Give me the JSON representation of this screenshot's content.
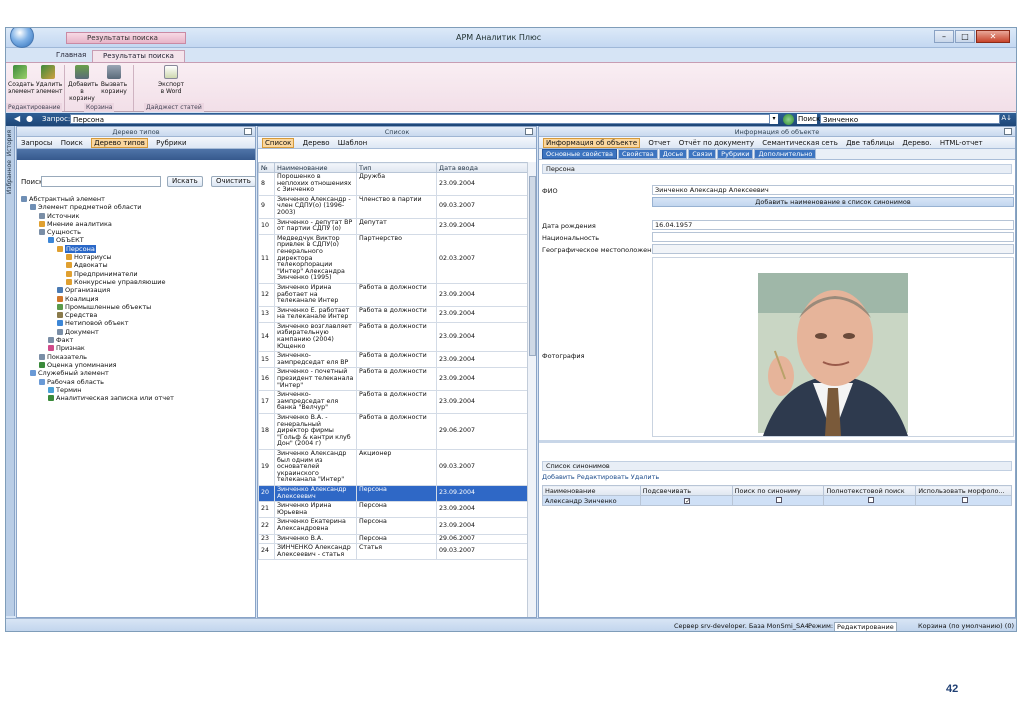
{
  "app": {
    "title": "АРМ Аналитик Плюс",
    "qat_label": "Результаты поиска"
  },
  "ribbon": {
    "tabs": [
      "Главная",
      "Результаты поиска"
    ],
    "buttons": [
      {
        "label": "Создать элемент"
      },
      {
        "label": "Удалить элемент"
      },
      {
        "label": "Добавить в корзину"
      },
      {
        "label": "Вызвать корзину"
      },
      {
        "label": "Экспорт в Word"
      }
    ],
    "groups": [
      "Редактирование",
      "Корзина",
      "Дайджест статей"
    ]
  },
  "querybar": {
    "label": "Запрос:",
    "query": "Персона",
    "search_label": "Поиск",
    "search_value": "Зинченко",
    "sort": "A↓"
  },
  "sidebar": {
    "labels": [
      "История",
      "Избранное"
    ]
  },
  "left": {
    "header": "Дерево типов",
    "toolbar": [
      "Запросы",
      "Поиск",
      "Дерево типов",
      "Рубрики"
    ],
    "search_label": "Поиск",
    "search_btn": "Искать",
    "clear_btn": "Очистить",
    "tree": [
      {
        "d": 0,
        "t": "Абстрактный элемент",
        "c": "#6f8fb5"
      },
      {
        "d": 1,
        "t": "Элемент предметной области",
        "c": "#6f8fb5"
      },
      {
        "d": 2,
        "t": "Источник",
        "c": "#7a8ea6"
      },
      {
        "d": 2,
        "t": "Мнение аналитика",
        "c": "#e0a030"
      },
      {
        "d": 2,
        "t": "Сущность",
        "c": "#7a8ea6"
      },
      {
        "d": 3,
        "t": "ОБЪЕКТ",
        "c": "#3c86d6"
      },
      {
        "d": 4,
        "t": "Персона",
        "c": "#e0a030",
        "sel": true
      },
      {
        "d": 5,
        "t": "Нотариусы",
        "c": "#e0a030"
      },
      {
        "d": 5,
        "t": "Адвокаты",
        "c": "#e0a030"
      },
      {
        "d": 5,
        "t": "Предприниматели",
        "c": "#e0a030"
      },
      {
        "d": 5,
        "t": "Конкурсные управляюшие",
        "c": "#e0a030"
      },
      {
        "d": 4,
        "t": "Организация",
        "c": "#4a7ab3"
      },
      {
        "d": 4,
        "t": "Коалиция",
        "c": "#d0762a"
      },
      {
        "d": 4,
        "t": "Промышленные объекты",
        "c": "#5a9a4a"
      },
      {
        "d": 4,
        "t": "Средства",
        "c": "#8a7a4a"
      },
      {
        "d": 4,
        "t": "Нетиповой объект",
        "c": "#3c86d6"
      },
      {
        "d": 4,
        "t": "Документ",
        "c": "#7a8ea6"
      },
      {
        "d": 3,
        "t": "Факт",
        "c": "#7a8ea6"
      },
      {
        "d": 3,
        "t": "Признак",
        "c": "#d04a8a"
      },
      {
        "d": 2,
        "t": "Показатель",
        "c": "#7a8ea6"
      },
      {
        "d": 2,
        "t": "Оценка упоминания",
        "c": "#3a8a3a"
      },
      {
        "d": 1,
        "t": "Служебный элемент",
        "c": "#6a9ad6"
      },
      {
        "d": 2,
        "t": "Рабочая область",
        "c": "#6a9ad6"
      },
      {
        "d": 3,
        "t": "Термин",
        "c": "#4aa0d6"
      },
      {
        "d": 3,
        "t": "Аналитическая записка или отчет",
        "c": "#3a8a3a"
      }
    ]
  },
  "middle": {
    "header": "Список",
    "toolbar": [
      "Список",
      "Дерево",
      "Шаблон"
    ],
    "columns": [
      "№",
      "Наименование",
      "Тип",
      "Дата ввода"
    ],
    "rows": [
      {
        "n": "8",
        "name": "Порошенко в неплохих отношениях с Зинченко",
        "type": "Дружба",
        "date": "23.09.2004"
      },
      {
        "n": "9",
        "name": "Зинченко Александр - член СДПУ(о) (1996-2003)",
        "type": "Членство в партии",
        "date": "09.03.2007"
      },
      {
        "n": "10",
        "name": "Зинченко - депутат ВР от партии СДПУ (о)",
        "type": "Депутат",
        "date": "23.09.2004"
      },
      {
        "n": "11",
        "name": "Медведчук Виктор привлек в СДПУ(о) генерального директора телекорпорации \"Интер\" Александра Зинченко (1995)",
        "type": "Партнерство",
        "date": "02.03.2007"
      },
      {
        "n": "12",
        "name": "Зинченко Ирина работает на телеканале Интер",
        "type": "Работа в должности",
        "date": "23.09.2004"
      },
      {
        "n": "13",
        "name": "Зинченко Е. работает на телеканале Интер",
        "type": "Работа в должности",
        "date": "23.09.2004"
      },
      {
        "n": "14",
        "name": "Зинченко возглавляет избирательную кампанию (2004) Ющенко",
        "type": "Работа в должности",
        "date": "23.09.2004"
      },
      {
        "n": "15",
        "name": "Зинченко-зампредседат еля ВР",
        "type": "Работа в должности",
        "date": "23.09.2004"
      },
      {
        "n": "16",
        "name": "Зинченко - почетный президент телеканала \"Интер\"",
        "type": "Работа в должности",
        "date": "23.09.2004"
      },
      {
        "n": "17",
        "name": "Зинченко-зампредседат еля банка \"Велчур\"",
        "type": "Работа в должности",
        "date": "23.09.2004"
      },
      {
        "n": "18",
        "name": "Зинченко В.А. - генеральный директор фирмы \"Гольф & кантри клуб Дон\" (2004 г)",
        "type": "Работа в должности",
        "date": "29.06.2007"
      },
      {
        "n": "19",
        "name": "Зинченко Александр был одним из основателей украинского телеканала \"Интер\"",
        "type": "Акционер",
        "date": "09.03.2007"
      },
      {
        "n": "20",
        "name": "Зинченко Александр Алексеевич",
        "type": "Персона",
        "date": "23.09.2004",
        "sel": true
      },
      {
        "n": "21",
        "name": "Зинченко Ирина Юрьевна",
        "type": "Персона",
        "date": "23.09.2004"
      },
      {
        "n": "22",
        "name": "Зинченко Екатерина Александровна",
        "type": "Персона",
        "date": "23.09.2004"
      },
      {
        "n": "23",
        "name": "Зинченко В.А.",
        "type": "Персона",
        "date": "29.06.2007"
      },
      {
        "n": "24",
        "name": "ЗИНЧЕНКО Александр Алексеевич - статья",
        "type": "Статья",
        "date": "09.03.2007"
      }
    ]
  },
  "right": {
    "header": "Информация об объекте",
    "toolbar": [
      "Информация об объекте",
      "Отчет",
      "Отчёт по документу",
      "Семантическая сеть",
      "Две таблицы",
      "Дерево.",
      "HTML-отчет"
    ],
    "tabs": [
      "Основные свойства",
      "Свойства",
      "Досье",
      "Связи",
      "Рубрики",
      "Дополнительно"
    ],
    "section": "Персона",
    "fields": {
      "fio_label": "ФИО",
      "fio": "Зинченко Александр Алексеевич",
      "add_synonym": "Добавить наименование в список синонимов",
      "birth_label": "Дата рождения",
      "birth": "16.04.1957",
      "nat_label": "Национальность",
      "nat": "",
      "geo_label": "Географическое местоположение",
      "geo": "",
      "photo_label": "Фотография"
    },
    "synonyms": {
      "title": "Список синонимов",
      "actions": [
        "Добавить",
        "Редактировать",
        "Удалить"
      ],
      "columns": [
        "Наименование",
        "Подсвечивать",
        "Поиск по синониму",
        "Полнотекстовой поиск",
        "Использовать морфоло..."
      ],
      "row": "Александр Зинченко"
    }
  },
  "status": {
    "server": "Сервер srv-developer. База MonSmi_SA4.",
    "mode_label": "Режим:",
    "mode": "Редактирование",
    "basket": "Корзина (по умолчанию) (0)"
  },
  "page_number": "42"
}
